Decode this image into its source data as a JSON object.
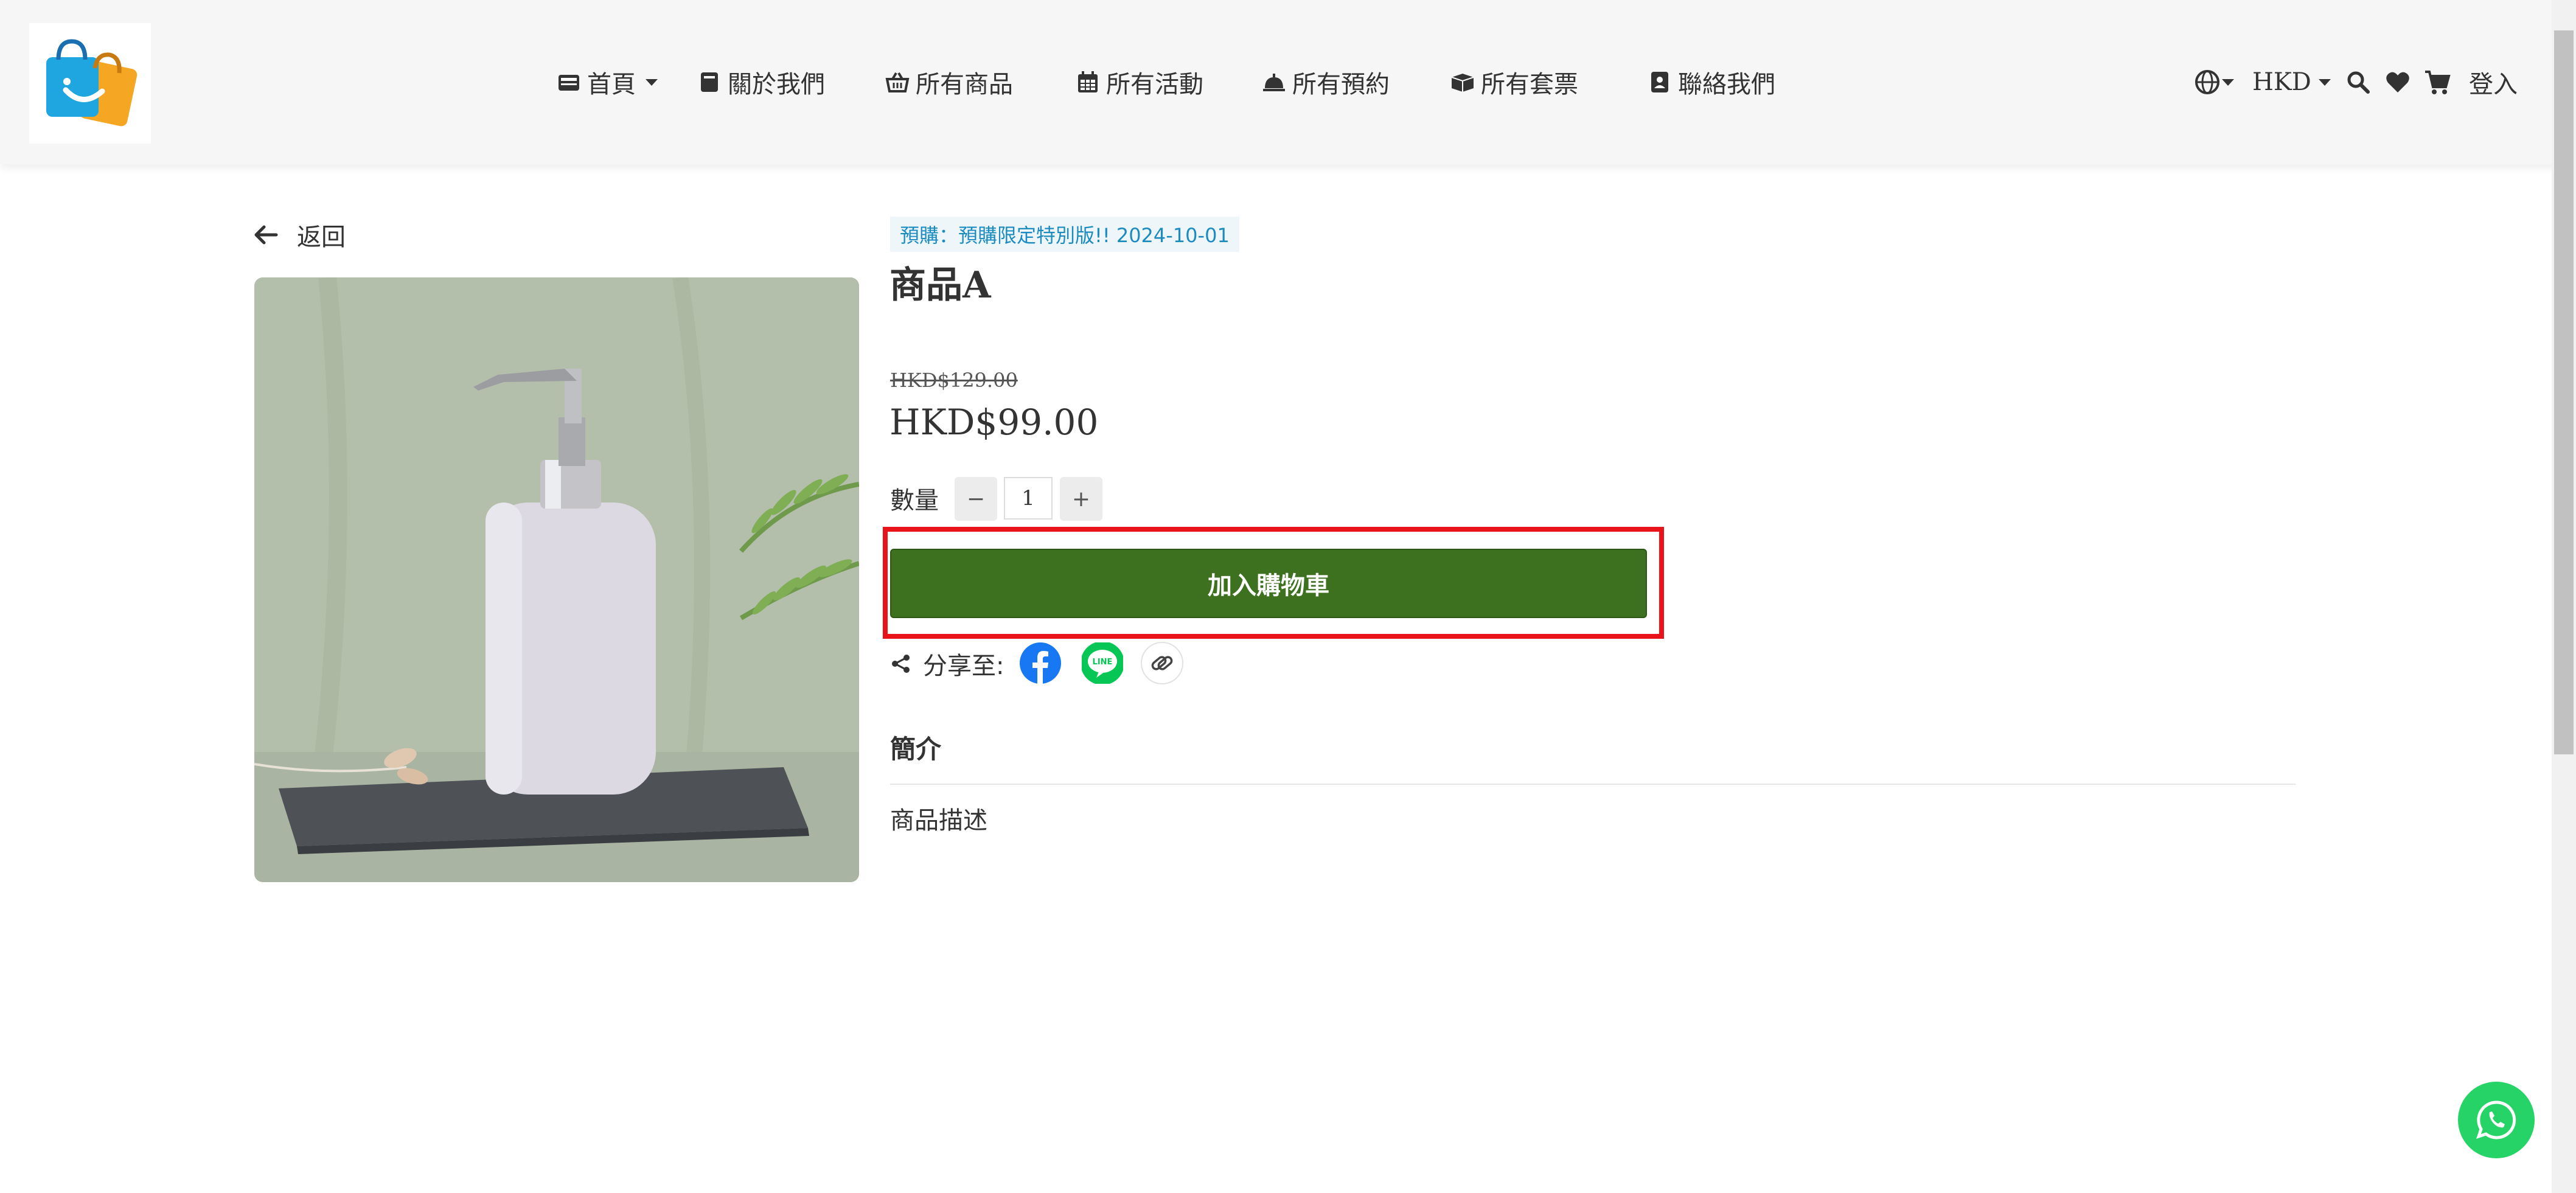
{
  "header": {
    "nav": [
      {
        "label": "首頁",
        "icon": "id-card-icon",
        "has_dropdown": true
      },
      {
        "label": "關於我們",
        "icon": "book-icon"
      },
      {
        "label": "所有商品",
        "icon": "basket-icon"
      },
      {
        "label": "所有活動",
        "icon": "calendar-icon"
      },
      {
        "label": "所有預約",
        "icon": "service-bell-icon"
      },
      {
        "label": "所有套票",
        "icon": "ticket-box-icon"
      },
      {
        "label": "聯絡我們",
        "icon": "address-book-icon"
      }
    ],
    "currency": "HKD",
    "login_label": "登入"
  },
  "main": {
    "back_label": "返回",
    "preorder_badge": "預購：預購限定特別版!! 2024-10-01",
    "product_title": "商品A",
    "original_price": "HKD$129.00",
    "sale_price": "HKD$99.00",
    "quantity_label": "數量",
    "quantity_value": "1",
    "minus_label": "−",
    "plus_label": "+",
    "add_to_cart_label": "加入購物車",
    "share_label": "分享至:",
    "description_heading": "簡介",
    "description_text": "商品描述"
  },
  "colors": {
    "primary_button": "#3d711f",
    "badge_text": "#1c8cc0",
    "highlight_border": "#e8141a",
    "whatsapp": "#25d366"
  }
}
